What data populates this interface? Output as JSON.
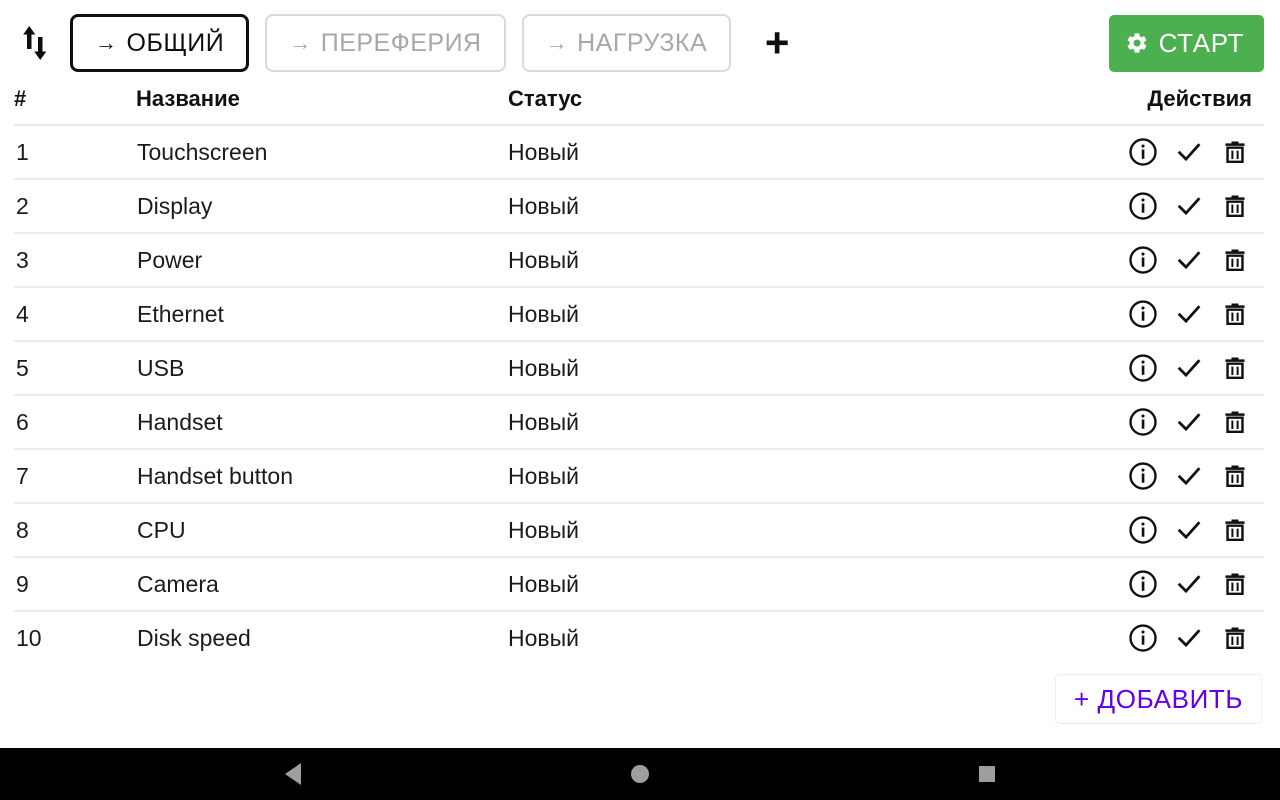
{
  "toolbar": {
    "sort_icon": "sort-updown-icon",
    "tabs": [
      {
        "label": "ОБЩИЙ",
        "arrow": "→",
        "active": true
      },
      {
        "label": "ПЕРЕФЕРИЯ",
        "arrow": "→",
        "active": false
      },
      {
        "label": "НАГРУЗКА",
        "arrow": "→",
        "active": false
      }
    ],
    "add_tab_label": "+",
    "start_label": "СТАРТ",
    "start_icon": "gear-icon",
    "start_color": "#4CAF50"
  },
  "table": {
    "headers": {
      "number": "#",
      "name": "Название",
      "status": "Статус",
      "actions": "Действия"
    },
    "rows": [
      {
        "num": "1",
        "name": "Touchscreen",
        "status": "Новый"
      },
      {
        "num": "2",
        "name": "Display",
        "status": "Новый"
      },
      {
        "num": "3",
        "name": "Power",
        "status": "Новый"
      },
      {
        "num": "4",
        "name": "Ethernet",
        "status": "Новый"
      },
      {
        "num": "5",
        "name": "USB",
        "status": "Новый"
      },
      {
        "num": "6",
        "name": "Handset",
        "status": "Новый"
      },
      {
        "num": "7",
        "name": "Handset button",
        "status": "Новый"
      },
      {
        "num": "8",
        "name": "CPU",
        "status": "Новый"
      },
      {
        "num": "9",
        "name": "Camera",
        "status": "Новый"
      },
      {
        "num": "10",
        "name": "Disk speed",
        "status": "Новый"
      }
    ],
    "row_action_icons": [
      "info-icon",
      "check-icon",
      "trash-icon"
    ]
  },
  "footer": {
    "add_label": "+ ДОБАВИТЬ",
    "add_color": "#6200EE"
  },
  "navbar": {
    "back": "back-triangle-icon",
    "home": "home-circle-icon",
    "recents": "recents-square-icon"
  }
}
